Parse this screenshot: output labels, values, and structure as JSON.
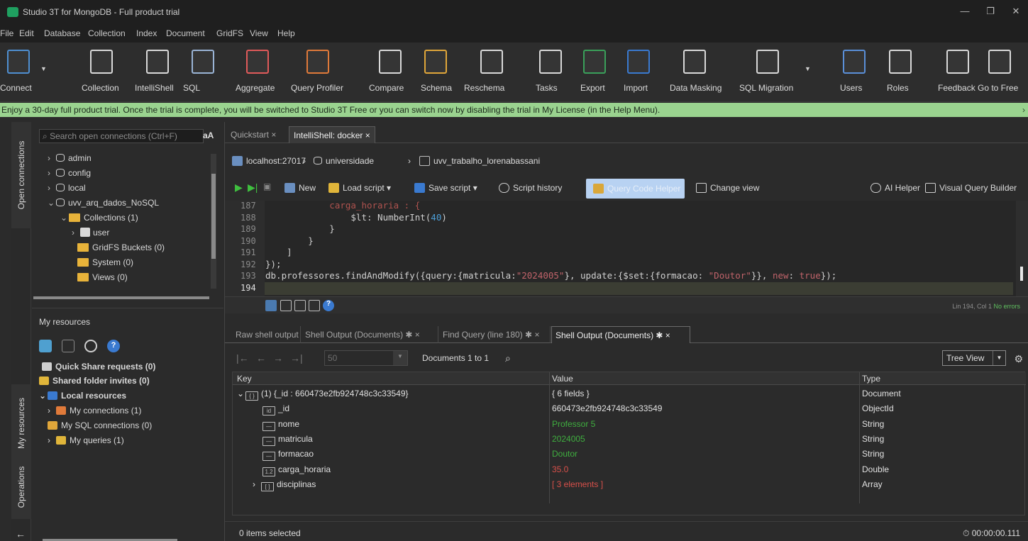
{
  "window": {
    "title": "Studio 3T for MongoDB - Full product trial",
    "minimize": "—",
    "restore": "❐",
    "close": "✕"
  },
  "menu": [
    "File",
    "Edit",
    "Database",
    "Collection",
    "Index",
    "Document",
    "GridFS",
    "View",
    "Help"
  ],
  "toolbar": [
    {
      "label": "Connect",
      "icon": "connect-icon",
      "color": "#4f8fd1"
    },
    {
      "label": "Collection",
      "icon": "collection-icon",
      "color": "#d9d9d9"
    },
    {
      "label": "IntelliShell",
      "icon": "intellishell-icon",
      "color": "#d9d9d9"
    },
    {
      "label": "SQL",
      "icon": "sql-icon",
      "color": "#9ab4d6"
    },
    {
      "label": "Aggregate",
      "icon": "aggregate-icon",
      "color": "#e05a5a"
    },
    {
      "label": "Query Profiler",
      "icon": "query-profiler-icon",
      "color": "#e07a3a"
    },
    {
      "label": "Compare",
      "icon": "compare-icon",
      "color": "#d9d9d9"
    },
    {
      "label": "Schema",
      "icon": "schema-icon",
      "color": "#e0a63a"
    },
    {
      "label": "Reschema",
      "icon": "reschema-icon",
      "color": "#d9d9d9"
    },
    {
      "label": "Tasks",
      "icon": "tasks-icon",
      "color": "#d9d9d9"
    },
    {
      "label": "Export",
      "icon": "export-icon",
      "color": "#3aa05a"
    },
    {
      "label": "Import",
      "icon": "import-icon",
      "color": "#3a7ad0"
    },
    {
      "label": "Data Masking",
      "icon": "data-masking-icon",
      "color": "#d9d9d9"
    },
    {
      "label": "SQL Migration",
      "icon": "sql-migration-icon",
      "color": "#d9d9d9"
    },
    {
      "label": "Users",
      "icon": "users-icon",
      "color": "#5a8fd8"
    },
    {
      "label": "Roles",
      "icon": "roles-icon",
      "color": "#d9d9d9"
    },
    {
      "label": "Feedback",
      "icon": "feedback-icon",
      "color": "#d9d9d9"
    },
    {
      "label": "Go to Free",
      "icon": "go-to-free-icon",
      "color": "#d9d9d9"
    }
  ],
  "trial_banner": "Enjoy a 30-day full product trial. Once the trial is complete, you will be switched to Studio 3T Free or you can switch now by disabling the trial in My License (in the Help Menu).",
  "vtabs": {
    "open_connections": "Open connections",
    "my_resources": "My resources",
    "operations": "Operations"
  },
  "connections": {
    "search_placeholder": "Search open connections (Ctrl+F)",
    "case_toggle": "aA",
    "tree": [
      {
        "label": "admin",
        "type": "db",
        "toggle": "›"
      },
      {
        "label": "config",
        "type": "db",
        "toggle": "›"
      },
      {
        "label": "local",
        "type": "db",
        "toggle": "›"
      },
      {
        "label": "uvv_arq_dados_NoSQL",
        "type": "db",
        "toggle": "⌄"
      },
      {
        "label": "Collections (1)",
        "type": "folder",
        "toggle": "⌄"
      },
      {
        "label": "user",
        "type": "collection",
        "toggle": "›"
      },
      {
        "label": "GridFS Buckets (0)",
        "type": "folder",
        "toggle": ""
      },
      {
        "label": "System (0)",
        "type": "folder",
        "toggle": ""
      },
      {
        "label": "Views (0)",
        "type": "folder",
        "toggle": ""
      }
    ]
  },
  "resources": {
    "title": "My resources",
    "items": [
      {
        "label": "Quick Share requests (0)",
        "bold": true
      },
      {
        "label": "Shared folder invites (0)",
        "bold": true
      },
      {
        "label": "Local resources",
        "bold": true
      },
      {
        "label": "My connections (1)",
        "bold": false
      },
      {
        "label": "My SQL connections (0)",
        "bold": false
      },
      {
        "label": "My queries (1)",
        "bold": false
      }
    ]
  },
  "tabs": [
    {
      "label": "Quickstart",
      "active": false
    },
    {
      "label": "IntelliShell: docker",
      "active": true
    }
  ],
  "breadcrumb": [
    "localhost:27017",
    "universidade",
    "uvv_trabalho_lorenabassani"
  ],
  "editor_toolbar": {
    "new": "New",
    "load_script": "Load script",
    "save_script": "Save script",
    "script_history": "Script history",
    "highlighted": "Query Code Helper",
    "change_view": "Change view",
    "ai_helper": "AI Helper",
    "visual_query_builder": "Visual Query Builder"
  },
  "code": {
    "lines": [
      {
        "n": "187",
        "text": "            carga_horaria : {"
      },
      {
        "n": "188",
        "text": "                $lt: NumberInt(40)"
      },
      {
        "n": "189",
        "text": "            }"
      },
      {
        "n": "190",
        "text": "        }"
      },
      {
        "n": "191",
        "text": "    ]"
      },
      {
        "n": "192",
        "text": "});"
      },
      {
        "n": "193",
        "text": "db.professores.findAndModify({query:{matricula:\"2024005\"}, update:{$set:{formacao: \"Doutor\"}}, new: true});"
      },
      {
        "n": "194",
        "text": ""
      }
    ],
    "position": "Lin 194, Col 1",
    "errors": "No errors"
  },
  "result_tabs": [
    {
      "label": "Raw shell output",
      "active": false
    },
    {
      "label": "Shell Output (Documents)",
      "active": false
    },
    {
      "label": "Find Query (line 180)",
      "active": false
    },
    {
      "label": "Shell Output (Documents)",
      "active": true
    }
  ],
  "result_toolbar": {
    "page_size": "50",
    "range": "Documents 1 to 1",
    "view": "Tree View"
  },
  "results": {
    "columns": [
      "Key",
      "Value",
      "Type"
    ],
    "rows": [
      {
        "key": "(1) {_id : 660473e2fb924748c3c33549}",
        "value": "{ 6 fields }",
        "type": "Document",
        "valueColor": "#e0e0e0",
        "indent": 0,
        "toggle": "⌄",
        "icon": "{ }"
      },
      {
        "key": "_id",
        "value": "660473e2fb924748c3c33549",
        "type": "ObjectId",
        "valueColor": "#e0e0e0",
        "indent": 1,
        "toggle": "",
        "icon": "id"
      },
      {
        "key": "nome",
        "value": "Professor 5",
        "type": "String",
        "valueColor": "#3fae3f",
        "indent": 1,
        "toggle": "",
        "icon": "—"
      },
      {
        "key": "matricula",
        "value": "2024005",
        "type": "String",
        "valueColor": "#3fae3f",
        "indent": 1,
        "toggle": "",
        "icon": "—"
      },
      {
        "key": "formacao",
        "value": "Doutor",
        "type": "String",
        "valueColor": "#3fae3f",
        "indent": 1,
        "toggle": "",
        "icon": "—"
      },
      {
        "key": "carga_horaria",
        "value": "35.0",
        "type": "Double",
        "valueColor": "#d8504a",
        "indent": 1,
        "toggle": "",
        "icon": "1.2"
      },
      {
        "key": "disciplinas",
        "value": "[ 3 elements ]",
        "type": "Array",
        "valueColor": "#d8504a",
        "indent": 1,
        "toggle": "›",
        "icon": "[ ]"
      }
    ]
  },
  "status": {
    "selected": "0 items selected",
    "time": "00:00:00.111"
  }
}
